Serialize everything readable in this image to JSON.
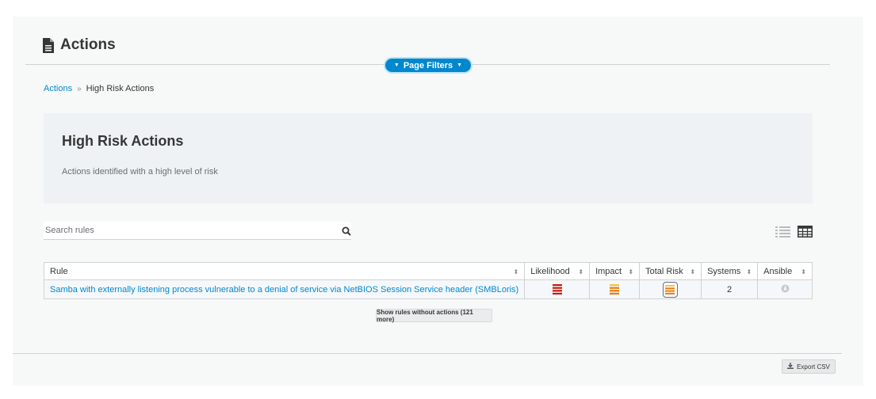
{
  "header": {
    "title": "Actions",
    "icon": "document-icon"
  },
  "filters": {
    "label": "Page Filters"
  },
  "breadcrumb": {
    "root": "Actions",
    "separator": "»",
    "current": "High Risk Actions"
  },
  "hero": {
    "title": "High Risk Actions",
    "subtitle": "Actions identified with a high level of risk"
  },
  "search": {
    "placeholder": "Search rules",
    "value": ""
  },
  "table": {
    "columns": [
      "Rule",
      "Likelihood",
      "Impact",
      "Total Risk",
      "Systems",
      "Ansible"
    ],
    "rows": [
      {
        "rule": "Samba with externally listening process vulnerable to a denial of service via NetBIOS Session Service header (SMBLoris)",
        "likelihood_level": 4,
        "impact_level": 3,
        "total_risk_level": 3,
        "systems": "2",
        "ansible_icon": "ansible-unsupported-icon"
      }
    ]
  },
  "show_more": {
    "label": "Show rules without actions (121 more)"
  },
  "export": {
    "label": "Export CSV"
  },
  "colors": {
    "accent": "#0088ce",
    "critical": "#c9190b",
    "moderate": "#ec7a08"
  }
}
